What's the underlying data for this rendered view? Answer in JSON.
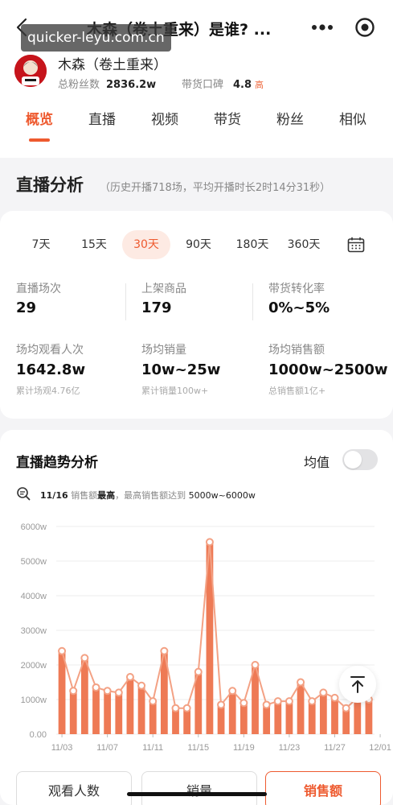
{
  "nav": {
    "title": "木森（卷土重来）是谁? ...",
    "watermark": "quicker-leyu.com.cn"
  },
  "author": {
    "name": "木森（卷土重来）",
    "fans_label": "总粉丝数",
    "fans_value": "2836.2w",
    "reputation_label": "带货口碑",
    "reputation_value": "4.8",
    "reputation_level": "高"
  },
  "tabs": [
    "概览",
    "直播",
    "视频",
    "带货",
    "粉丝",
    "相似"
  ],
  "live": {
    "title": "直播分析",
    "subtitle": "（历史开播718场，平均开播时长2时14分31秒）",
    "ranges": [
      "7天",
      "15天",
      "30天",
      "90天",
      "180天",
      "360天"
    ],
    "active_range": "30天",
    "metrics": [
      {
        "label": "直播场次",
        "value": "29",
        "note": ""
      },
      {
        "label": "上架商品",
        "value": "179",
        "note": ""
      },
      {
        "label": "带货转化率",
        "value": "0%~5%",
        "note": ""
      },
      {
        "label": "场均观看人次",
        "value": "1642.8w",
        "note": "累计场观4.76亿"
      },
      {
        "label": "场均销量",
        "value": "10w~25w",
        "note": "累计销量100w+"
      },
      {
        "label": "场均销售额",
        "value": "1000w~2500w",
        "note": "总销售额1亿+"
      }
    ]
  },
  "trend": {
    "title": "直播趋势分析",
    "toggle_label": "均值",
    "toggle_on": false,
    "insight_date": "11/16",
    "insight_mid": "销售额",
    "insight_highlight": "最高",
    "insight_tail": "，最高销售额达到",
    "insight_value": "5000w~6000w"
  },
  "chart_data": {
    "type": "bar",
    "title": "",
    "xlabel": "",
    "ylabel": "",
    "ylim": [
      0,
      6000
    ],
    "y_ticks": [
      "0.00",
      "1000w",
      "2000w",
      "3000w",
      "4000w",
      "5000w",
      "6000w"
    ],
    "x_tick_labels": [
      "11/03",
      "11/07",
      "11/11",
      "11/15",
      "11/19",
      "11/23",
      "11/27",
      "12/01"
    ],
    "values": [
      2400,
      1250,
      2200,
      1350,
      1250,
      1200,
      1650,
      1400,
      950,
      2400,
      750,
      750,
      1800,
      5550,
      850,
      1250,
      900,
      2000,
      850,
      950,
      950,
      1500,
      950,
      1200,
      1050,
      750,
      1050,
      1000
    ],
    "color": "#ee7a55",
    "line_color": "#f3a184",
    "grid": true
  },
  "bottom_tabs": [
    "观看人数",
    "销量",
    "销售额"
  ],
  "active_bottom_tab": "销售额",
  "colors": {
    "accent": "#ee5a2f",
    "bar": "#ee7a55"
  }
}
